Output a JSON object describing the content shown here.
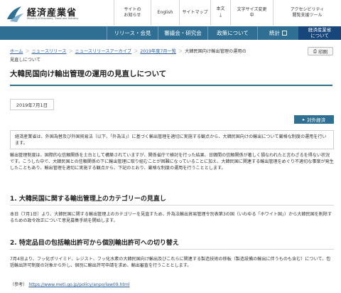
{
  "header": {
    "logo_title": "経済産業省",
    "logo_subtitle": "Ministry of Economy, Trade and Industry",
    "utility": [
      {
        "label": "サイトの",
        "label2": "使い方",
        "prefix": "中",
        "suffix": ""
      },
      {
        "label": "お知らせ",
        "label2": "",
        "prefix": "",
        "suffix": ""
      },
      {
        "label": "English",
        "label2": "",
        "prefix": "",
        "suffix": ""
      },
      {
        "label": "サイトマップ",
        "label2": "",
        "prefix": "",
        "suffix": ""
      },
      {
        "label": "本文",
        "label2": "",
        "prefix": "",
        "suffix": ""
      },
      {
        "label": "文字サイズ変更",
        "label2": "",
        "prefix": "",
        "suffix": ""
      },
      {
        "label": "アクセシビリティ",
        "label2": "閲覧支援ツール",
        "prefix": "",
        "suffix": ""
      }
    ],
    "u1a": "中",
    "u1b": "サイトの",
    "u1c": "使い方",
    "u2": "お知らせ",
    "u3": "English",
    "u4": "サイトマップ",
    "u5": "本文",
    "u6": "文字サイズ変更",
    "u6b": "小",
    "u7a": "アクセシビリティ",
    "u7b": "閲覧支援ツール"
  },
  "nav": {
    "items": [
      "リリース・会見",
      "審議会・研究会",
      "政策について",
      "統計"
    ],
    "meti_line1": "経済産業省",
    "meti_line2": "について"
  },
  "breadcrumb": {
    "items": [
      "ホーム",
      "ニュースリリース",
      "ニュースリリースアーカイブ",
      "2019年度7月一覧"
    ],
    "current_line1": "大韓民国向け輸出管理の運用の",
    "current_line2": "見直しについて"
  },
  "print_label": "印刷",
  "title": "大韓民国向け輸出管理の運用の見直しについて",
  "date": "2019年7月1日",
  "tag": "対外経済",
  "lead": "経済産業省は、外国為替及び外国貿易法（以下、「外為法」）に基づく輸出管理を適切に実施する観点から、大韓民国向けの輸出について厳格な制度の運用を行います。",
  "paragraph1": "輸出管理制度は、国際的な信頼関係を土台として構築されていますが、関係省庁で検討を行った結果、日韓間の信頼関係が著しく損なわれたと言わざるを得ない状況です。こうした中で、大韓民国との信頼関係の下に輸出管理に取り組むことが困難になっていることに加え、大韓民国に関連する輸出管理をめぐり不適切な事案が発生したこともあり、輸出管理を適切に実施する観点から、下記のとおり、厳格な制度の運用を行うこととします。",
  "section1": "1.  大韓民国に関する輸出管理上のカテゴリーの見直し",
  "paragraph2": "本日（7月1日）より、大韓民国に関する輸出管理上のカテゴリーを見直すため、外為法輸出貿易管理令別表第3の国（いわゆる「ホワイト国」）から大韓民国を削除するための政令改正について意見募集手続を開始します。",
  "section2": "2.  特定品目の包括輸出許可から個別輸出許可への切り替え",
  "paragraph3": "7月4日より、フッ化ポリイミド、レジスト、フッ化水素の大韓民国向け輸出及びこれらに関連する製造技術の移転（製造設備の輸出に伴うものも含む）について、包括輸出許可制度の対象から外し、個別に輸出許可申請を求め、輸出審査を行うこととします。",
  "reference_label": "（参考）",
  "reference_url": "https://www.meti.go.jp/policy/anpo/law09.html",
  "colors": {
    "nav": "#2e6f93",
    "meti_button": "#16467a",
    "link": "#2a5b9b"
  }
}
